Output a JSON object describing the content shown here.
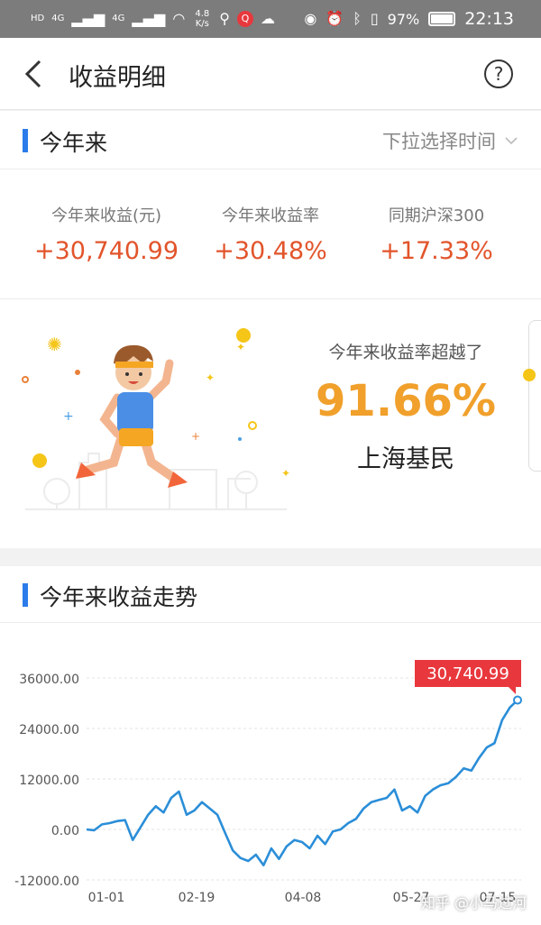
{
  "status_bar": {
    "hd": "HD",
    "net1": "4G",
    "net2": "4G",
    "speed_value": "4.8",
    "speed_unit": "K/s",
    "app_badge": "Q",
    "battery": "97%",
    "time": "22:13"
  },
  "header": {
    "title": "收益明细"
  },
  "summary": {
    "section_title": "今年来",
    "time_select_label": "下拉选择时间",
    "stats": [
      {
        "label": "今年来收益(元)",
        "value": "+30,740.99"
      },
      {
        "label": "今年来收益率",
        "value": "+30.48%"
      },
      {
        "label": "同期沪深300",
        "value": "+17.33%"
      }
    ],
    "rank_caption": "今年来收益率超越了",
    "rank_percent": "91.66%",
    "rank_group": "上海基民"
  },
  "trend": {
    "section_title": "今年来收益走势",
    "watermark": "知乎 @小马过河"
  },
  "colors": {
    "accent_blue": "#2b7ce9",
    "gain_red": "#e2542b",
    "rank_orange": "#f0a02b",
    "callout_red": "#e8383d"
  },
  "chart_data": {
    "type": "line",
    "title": "",
    "xlabel": "",
    "ylabel": "",
    "y_ticks": [
      "36000.00",
      "24000.00",
      "12000.00",
      "0.00",
      "-12000.00"
    ],
    "y_tick_values": [
      36000,
      24000,
      12000,
      0,
      -12000
    ],
    "ylim": [
      -12000,
      36000
    ],
    "x_ticks": [
      "01-01",
      "02-19",
      "04-08",
      "05-27",
      "07-15"
    ],
    "grid": true,
    "callout_label": "30,740.99",
    "series": [
      {
        "x": [
          "01-01",
          "01-04",
          "01-08",
          "01-11",
          "01-15",
          "01-18",
          "01-22",
          "01-25",
          "01-29",
          "02-01",
          "02-05",
          "02-08",
          "02-12",
          "02-15",
          "02-19",
          "02-22",
          "02-26",
          "03-01",
          "03-05",
          "03-08",
          "03-12",
          "03-15",
          "03-19",
          "03-22",
          "03-26",
          "03-29",
          "04-02",
          "04-05",
          "04-08",
          "04-12",
          "04-15",
          "04-19",
          "04-22",
          "04-26",
          "04-29",
          "05-03",
          "05-06",
          "05-10",
          "05-13",
          "05-17",
          "05-20",
          "05-24",
          "05-27",
          "05-31",
          "06-03",
          "06-07",
          "06-10",
          "06-14",
          "06-17",
          "06-21",
          "06-24",
          "06-28",
          "07-01",
          "07-05",
          "07-08",
          "07-12",
          "07-15"
        ],
        "values": [
          0,
          -200,
          1200,
          1500,
          2000,
          2200,
          -2500,
          500,
          3500,
          5500,
          4000,
          7500,
          9000,
          3500,
          4500,
          6500,
          5000,
          3500,
          -800,
          -5000,
          -6800,
          -7500,
          -6000,
          -8500,
          -4500,
          -7000,
          -4000,
          -2500,
          -3000,
          -4500,
          -1500,
          -3500,
          -500,
          0,
          1500,
          2500,
          5000,
          6500,
          7000,
          7500,
          9500,
          4500,
          5500,
          4000,
          8000,
          9500,
          10500,
          11000,
          12500,
          14500,
          14000,
          17000,
          19500,
          20500,
          26000,
          29000,
          30740.99
        ]
      }
    ]
  }
}
